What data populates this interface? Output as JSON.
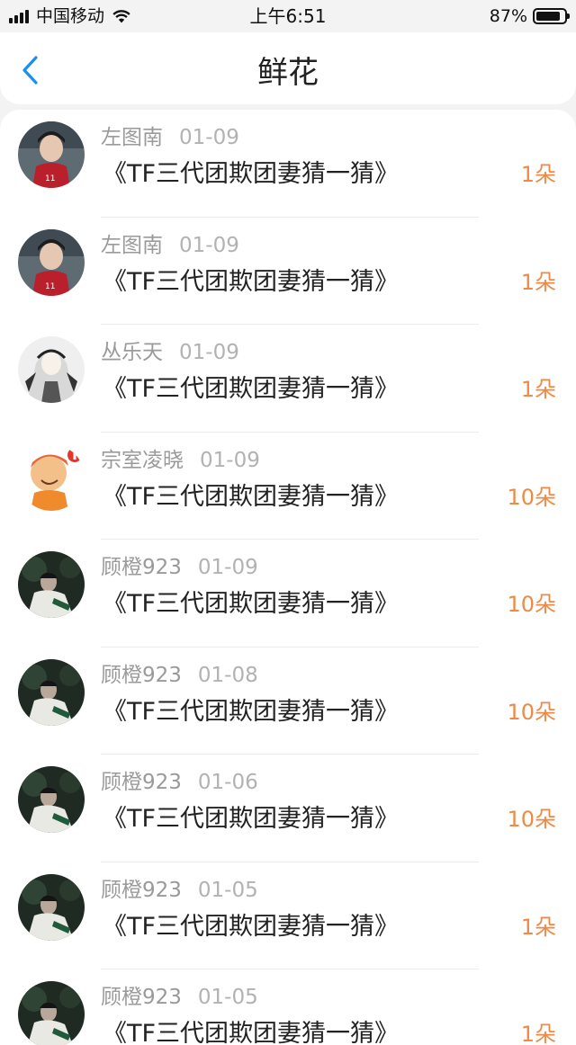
{
  "status_bar": {
    "carrier": "中国移动",
    "time": "上午6:51",
    "battery": "87%"
  },
  "nav": {
    "title": "鲜花",
    "back_icon": "chevron-left-icon",
    "accent": "#1a8ff0"
  },
  "accent_count_color": "#ee8a45",
  "items": [
    {
      "user": "左图南",
      "date": "01-09",
      "title": "《TF三代团欺团妻猜一猜》",
      "count": "1朵",
      "avatar": "boy-red-jersey"
    },
    {
      "user": "左图南",
      "date": "01-09",
      "title": "《TF三代团欺团妻猜一猜》",
      "count": "1朵",
      "avatar": "boy-red-jersey"
    },
    {
      "user": "丛乐天",
      "date": "01-09",
      "title": "《TF三代团欺团妻猜一猜》",
      "count": "1朵",
      "avatar": "sketch-girl"
    },
    {
      "user": "宗室凌晓",
      "date": "01-09",
      "title": "《TF三代团欺团妻猜一猜》",
      "count": "10朵",
      "avatar": "cartoon-boy"
    },
    {
      "user": "顾橙923",
      "date": "01-09",
      "title": "《TF三代团欺团妻猜一猜》",
      "count": "10朵",
      "avatar": "dark-photo"
    },
    {
      "user": "顾橙923",
      "date": "01-08",
      "title": "《TF三代团欺团妻猜一猜》",
      "count": "10朵",
      "avatar": "dark-photo"
    },
    {
      "user": "顾橙923",
      "date": "01-06",
      "title": "《TF三代团欺团妻猜一猜》",
      "count": "10朵",
      "avatar": "dark-photo"
    },
    {
      "user": "顾橙923",
      "date": "01-05",
      "title": "《TF三代团欺团妻猜一猜》",
      "count": "1朵",
      "avatar": "dark-photo"
    },
    {
      "user": "顾橙923",
      "date": "01-05",
      "title": "《TF三代团欺团妻猜一猜》",
      "count": "1朵",
      "avatar": "dark-photo"
    }
  ]
}
